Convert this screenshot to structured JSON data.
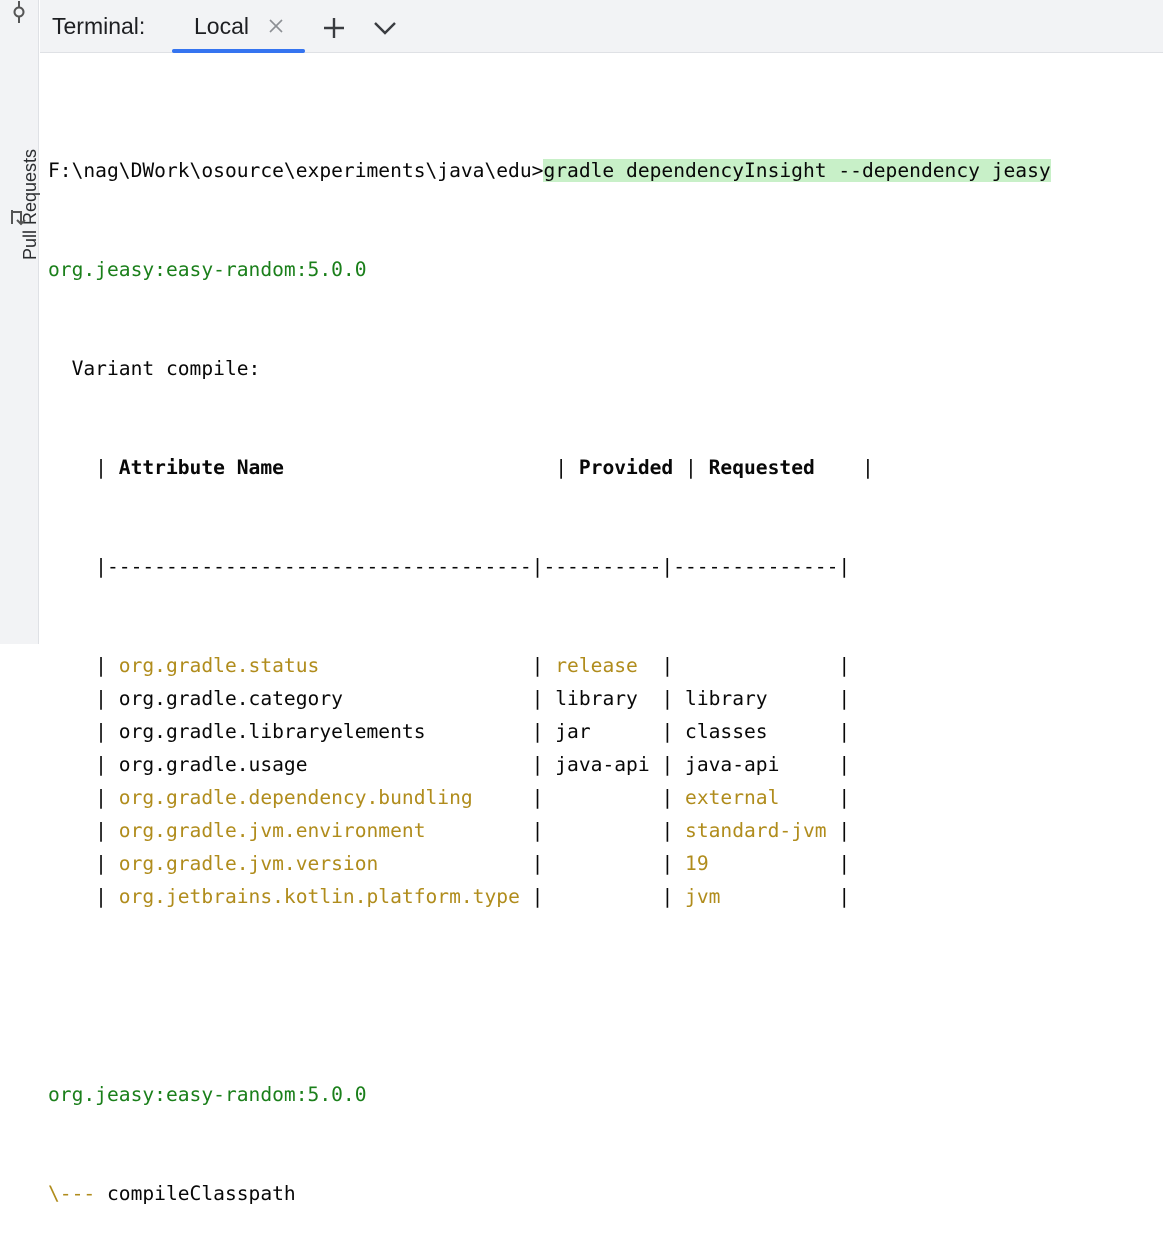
{
  "sidebar": {
    "pull_requests_label": "Pull Requests"
  },
  "header": {
    "title": "Terminal:",
    "tab_label": "Local"
  },
  "terminal": {
    "prompt": "F:\\nag\\DWork\\osource\\experiments\\java\\edu>",
    "command": "gradle dependencyInsight --dependency jeasy",
    "module_line": "org.jeasy:easy-random:5.0.0",
    "variant_line": "  Variant compile:",
    "table": {
      "header": [
        "Attribute Name",
        "Provided",
        "Requested"
      ],
      "separator": "    |------------------------------------|----------|--------------|",
      "rows": [
        {
          "name": "org.gradle.status",
          "provided": "release",
          "requested": "",
          "highlight": true
        },
        {
          "name": "org.gradle.category",
          "provided": "library",
          "requested": "library",
          "highlight": false
        },
        {
          "name": "org.gradle.libraryelements",
          "provided": "jar",
          "requested": "classes",
          "highlight": false
        },
        {
          "name": "org.gradle.usage",
          "provided": "java-api",
          "requested": "java-api",
          "highlight": false
        },
        {
          "name": "org.gradle.dependency.bundling",
          "provided": "",
          "requested": "external",
          "highlight": true
        },
        {
          "name": "org.gradle.jvm.environment",
          "provided": "",
          "requested": "standard-jvm",
          "highlight": true
        },
        {
          "name": "org.gradle.jvm.version",
          "provided": "",
          "requested": "19",
          "highlight": true
        },
        {
          "name": "org.jetbrains.kotlin.platform.type",
          "provided": "",
          "requested": "jvm",
          "highlight": true
        }
      ]
    },
    "module_line_2": "org.jeasy:easy-random:5.0.0",
    "tree_prefix": "\\---",
    "tree_item": "compileClasspath"
  },
  "colors": {
    "green": "#1a7f1a",
    "olive": "#b08c1c",
    "command_highlight": "#c8f0c8",
    "tab_underline": "#3574f0"
  }
}
